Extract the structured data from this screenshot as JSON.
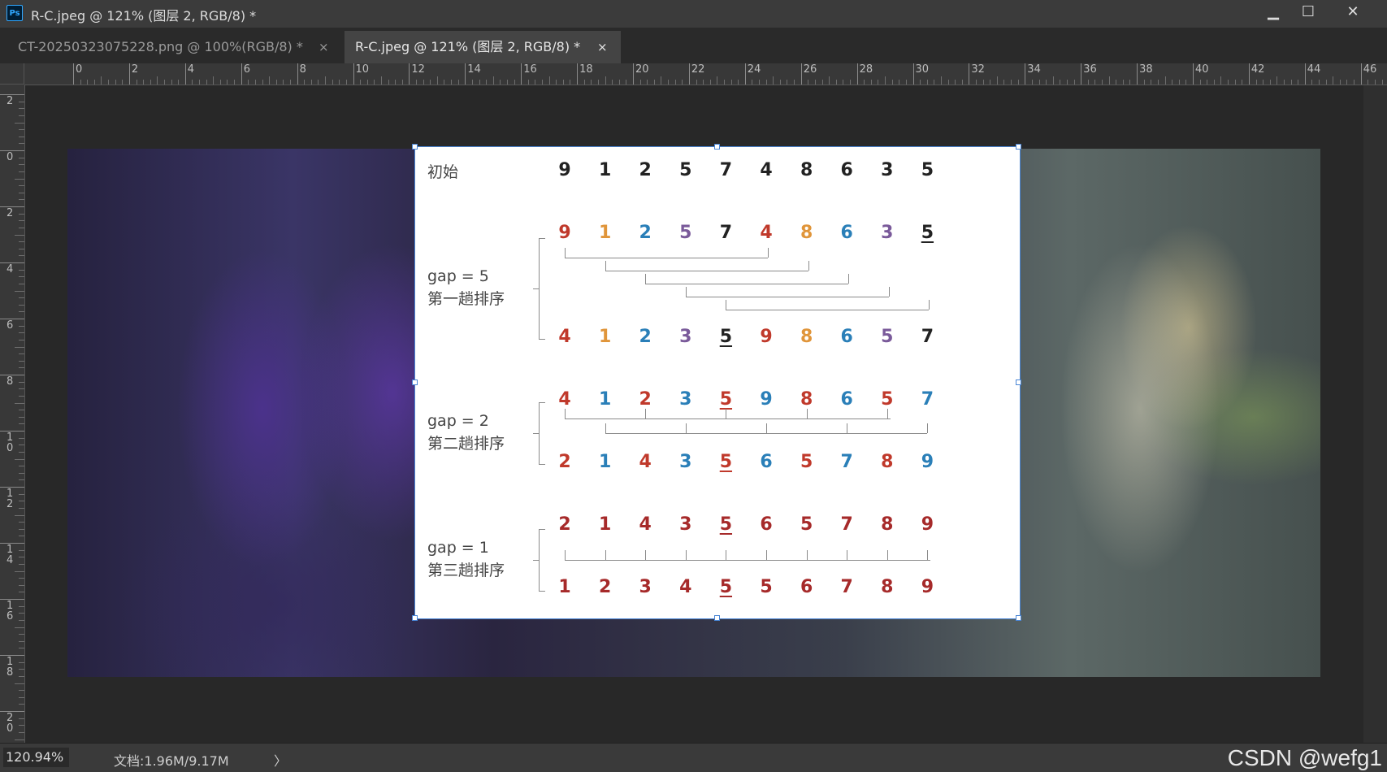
{
  "window": {
    "app_icon": "Ps",
    "title": "R-C.jpeg @ 121% (图层 2, RGB/8) *",
    "minimize": "▁",
    "maximize": "☐",
    "close": "✕"
  },
  "tabs": [
    {
      "label": "CT-20250323075228.png @ 100%(RGB/8) *",
      "close": "×",
      "active": false
    },
    {
      "label": "R-C.jpeg @ 121% (图层 2, RGB/8) *",
      "close": "×",
      "active": true
    }
  ],
  "ruler": {
    "top_labels": [
      "0",
      "2",
      "4",
      "6",
      "8",
      "10",
      "12",
      "14",
      "16",
      "18",
      "20",
      "22",
      "24",
      "26",
      "28",
      "30",
      "32",
      "34",
      "36",
      "38",
      "40",
      "42",
      "44",
      "46"
    ],
    "left_labels": [
      "2",
      "0",
      "2",
      "4",
      "6",
      "8",
      "10",
      "12",
      "14",
      "16",
      "18",
      "20"
    ]
  },
  "diagram": {
    "initial_label": "初始",
    "initial": [
      "9",
      "1",
      "2",
      "5",
      "7",
      "4",
      "8",
      "6",
      "3",
      "5"
    ],
    "pass1_label_gap": "gap = 5",
    "pass1_label_name": "第一趟排序",
    "pass1_top": [
      "9",
      "1",
      "2",
      "5",
      "7",
      "4",
      "8",
      "6",
      "3",
      "5"
    ],
    "pass1_bottom": [
      "4",
      "1",
      "2",
      "3",
      "5",
      "9",
      "8",
      "6",
      "5",
      "7"
    ],
    "pass2_label_gap": "gap = 2",
    "pass2_label_name": "第二趟排序",
    "pass2_top": [
      "4",
      "1",
      "2",
      "3",
      "5",
      "9",
      "8",
      "6",
      "5",
      "7"
    ],
    "pass2_bottom": [
      "2",
      "1",
      "4",
      "3",
      "5",
      "6",
      "5",
      "7",
      "8",
      "9"
    ],
    "pass3_label_gap": "gap = 1",
    "pass3_label_name": "第三趟排序",
    "pass3_top": [
      "2",
      "1",
      "4",
      "3",
      "5",
      "6",
      "5",
      "7",
      "8",
      "9"
    ],
    "pass3_bottom": [
      "1",
      "2",
      "3",
      "4",
      "5",
      "5",
      "6",
      "7",
      "8",
      "9"
    ],
    "colors": {
      "black": "#222222",
      "red": "#c0392b",
      "orange": "#e0953a",
      "blue": "#2a7fb8",
      "purple": "#7a5a9a",
      "darkred": "#a62a2a"
    }
  },
  "status": {
    "zoom": "120.94%",
    "doc": "文档:1.96M/9.17M",
    "arrow": "〉",
    "watermark": "CSDN @wefg1"
  }
}
